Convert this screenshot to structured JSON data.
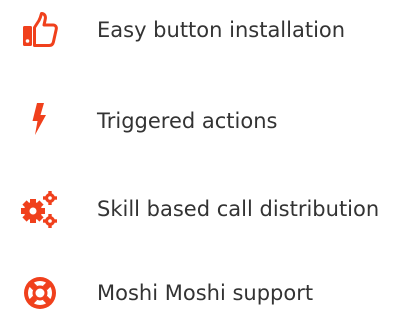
{
  "accent_color": "#f0401c",
  "text_color": "#333333",
  "features": [
    {
      "icon": "thumbs-up-icon",
      "label": "Easy button installation"
    },
    {
      "icon": "lightning-bolt-icon",
      "label": "Triggered actions"
    },
    {
      "icon": "gears-icon",
      "label": "Skill based call distribution"
    },
    {
      "icon": "life-ring-icon",
      "label": "Moshi Moshi support"
    }
  ]
}
